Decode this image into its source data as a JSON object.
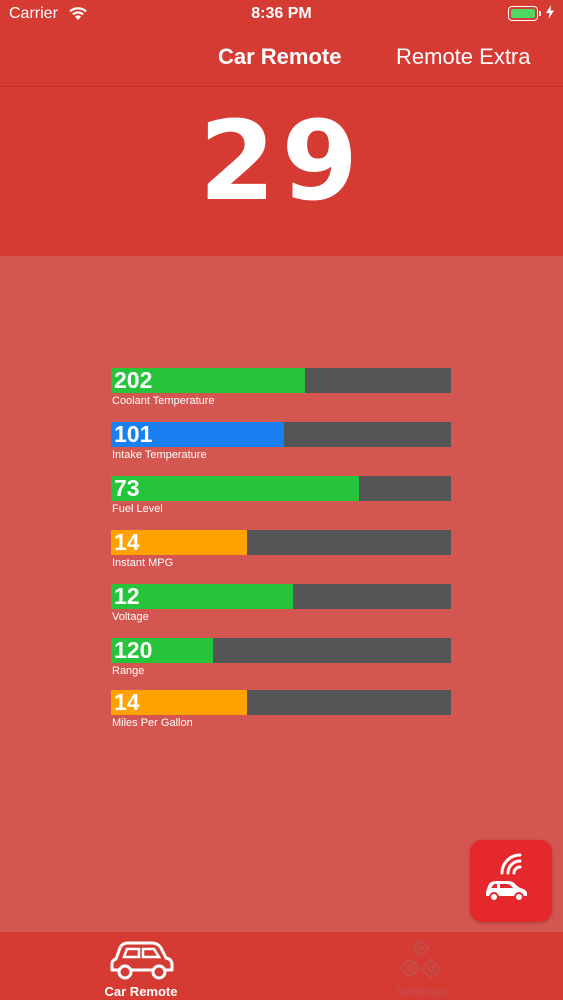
{
  "status_bar": {
    "carrier": "Carrier",
    "time": "8:36 PM",
    "icons": [
      "wifi-icon",
      "battery-icon",
      "charging-bolt-icon"
    ]
  },
  "nav": {
    "title": "Car Remote",
    "right_button": "Remote Extra"
  },
  "main_value": "29",
  "gauges": [
    {
      "value": "202",
      "label": "Coolant Temperature",
      "fill_fraction": 0.57,
      "color": "#26c43a"
    },
    {
      "value": "101",
      "label": "Intake Temperature",
      "fill_fraction": 0.51,
      "color": "#1a7ff0"
    },
    {
      "value": "73",
      "label": "Fuel Level",
      "fill_fraction": 0.73,
      "color": "#26c43a"
    },
    {
      "value": "14",
      "label": "Instant MPG",
      "fill_fraction": 0.4,
      "color": "#ffa200"
    },
    {
      "value": "12",
      "label": "Voltage",
      "fill_fraction": 0.535,
      "color": "#26c43a"
    },
    {
      "value": "120",
      "label": "Range",
      "fill_fraction": 0.3,
      "color": "#26c43a"
    },
    {
      "value": "14",
      "label": "Miles Per Gallon",
      "fill_fraction": 0.4,
      "color": "#ffa200"
    }
  ],
  "remote_button": {
    "icon": "car-remote-signal-icon"
  },
  "tabs": [
    {
      "label": "Car Remote",
      "icon": "car-icon",
      "selected": true
    },
    {
      "label": "Settings",
      "icon": "gears-icon",
      "selected": false
    }
  ],
  "colors": {
    "header": "#d53a33",
    "body": "#d35650",
    "track": "#555555",
    "remote_button": "#e5282c"
  }
}
